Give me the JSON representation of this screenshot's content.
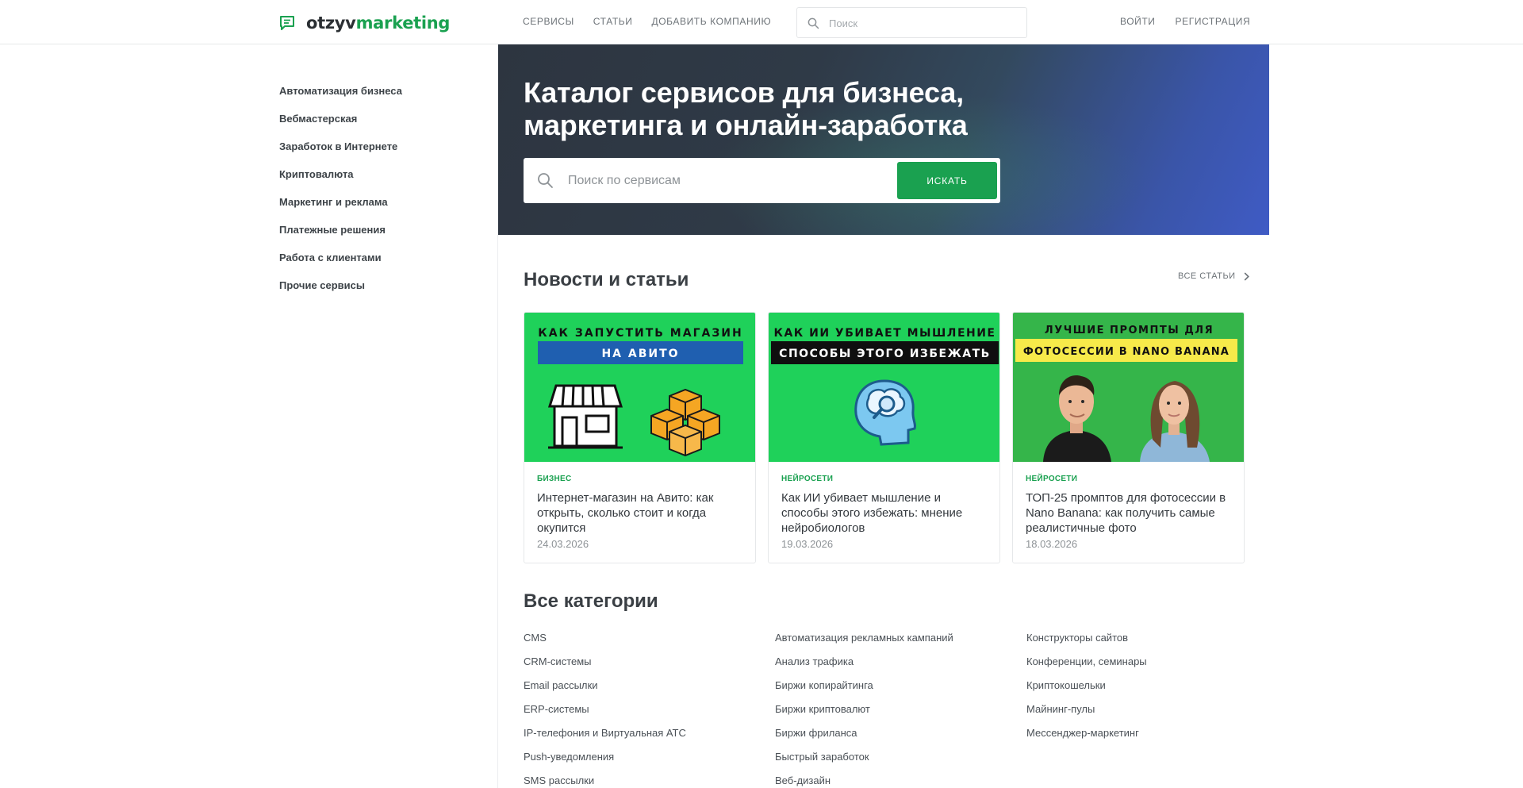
{
  "header": {
    "logo_part1": "otzyv",
    "logo_part2": "marketing",
    "nav": [
      "Сервисы",
      "Статьи",
      "Добавить компанию"
    ],
    "search_placeholder": "Поиск",
    "login": "Войти",
    "register": "Регистрация"
  },
  "sidebar": {
    "items": [
      "Автоматизация бизнеса",
      "Вебмастерская",
      "Заработок в Интернете",
      "Криптовалюта",
      "Маркетинг и реклама",
      "Платежные решения",
      "Работа с клиентами",
      "Прочие сервисы"
    ]
  },
  "hero": {
    "title_line1": "Каталог сервисов для бизнеса,",
    "title_line2": "маркетинга и онлайн-заработка",
    "search_placeholder": "Поиск по сервисам",
    "search_button": "Искать"
  },
  "news": {
    "title": "Новости и статьи",
    "all_link": "Все статьи",
    "cards": [
      {
        "banner_line1": "КАК ЗАПУСТИТЬ МАГАЗИН",
        "banner_line2": "НА АВИТО",
        "tag": "Бизнес",
        "title": "Интернет-магазин на Авито: как открыть, сколько стоит и когда окупится",
        "date": "24.03.2026"
      },
      {
        "banner_line1": "КАК ИИ УБИВАЕТ МЫШЛЕНИЕ",
        "banner_line2": "СПОСОБЫ ЭТОГО ИЗБЕЖАТЬ",
        "tag": "Нейросети",
        "title": "Как ИИ убивает мышление и способы этого избежать: мнение нейробиологов",
        "date": "19.03.2026"
      },
      {
        "banner_line1": "ЛУЧШИЕ ПРОМПТЫ ДЛЯ",
        "banner_line2": "ФОТОСЕССИИ В NANO BANANA",
        "tag": "Нейросети",
        "title": "ТОП-25 промптов для фотосессии в Nano Banana: как получить самые реалистичные фото",
        "date": "18.03.2026"
      }
    ]
  },
  "categories": {
    "title": "Все категории",
    "columns": [
      [
        "CMS",
        "CRM-системы",
        "Email рассылки",
        "ERP-системы",
        "IP-телефония и Виртуальная АТС",
        "Push-уведомления",
        "SMS рассылки"
      ],
      [
        "Автоматизация рекламных кампаний",
        "Анализ трафика",
        "Биржи копирайтинга",
        "Биржи криптовалют",
        "Биржи фриланса",
        "Быстрый заработок",
        "Веб-дизайн"
      ],
      [
        "Конструкторы сайтов",
        "Конференции, семинары",
        "Криптокошельки",
        "Майнинг-пулы",
        "Мессенджер-маркетинг"
      ]
    ]
  },
  "colors": {
    "brand_green": "#1aa150",
    "card_banner_green": "#1fd15a",
    "avito_blue": "#1f5fb0",
    "banana_yellow": "#f7ea4a"
  }
}
